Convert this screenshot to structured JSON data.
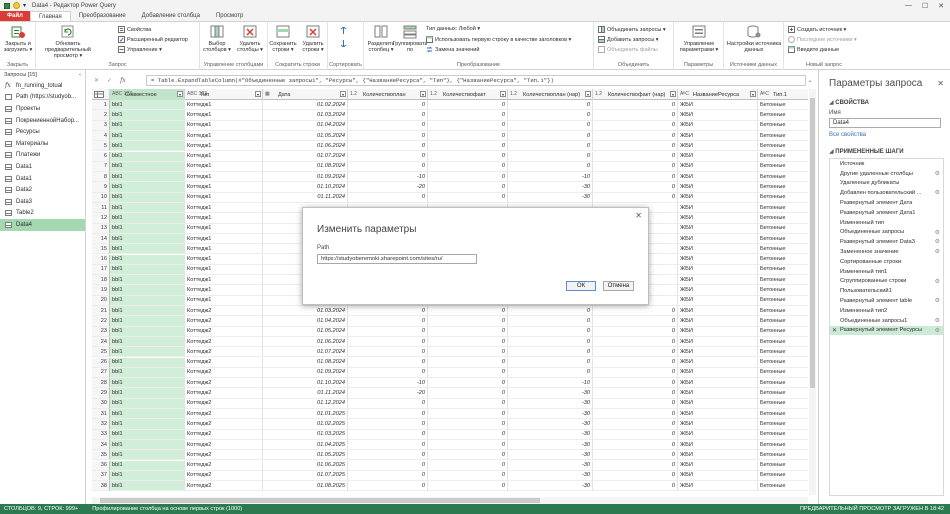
{
  "window": {
    "title": "Data4 - Редактор Power Query",
    "minimize": "—",
    "maximize": "☐",
    "close": "✕"
  },
  "tabs": [
    "Файл",
    "Главная",
    "Преобразование",
    "Добавление столбца",
    "Просмотр"
  ],
  "ribbon": {
    "close_apply": "Закрыть и загрузить ▾",
    "close_group": "Закрыть",
    "refresh": "Обновить предварительный просмотр ▾",
    "properties": "Свойства",
    "advanced_editor": "Расширенный редактор",
    "manage": "Управление ▾",
    "query_group": "Запрос",
    "choose_cols": "Выбор столбцов ▾",
    "remove_cols": "Удалить столбцы ▾",
    "manage_cols_group": "Управление столбцами",
    "keep_rows": "Сохранить строки ▾",
    "remove_rows": "Удалить строки ▾",
    "reduce_rows_group": "Сократить строки",
    "sort_group": "Сортировать",
    "split_col": "Разделить столбец ▾",
    "group_by": "Группировать по",
    "data_type": "Тип данных: Любой ▾",
    "first_row_headers": "Использовать первую строку в качестве заголовков ▾",
    "replace_values": "Замена значений",
    "transform_group": "Преобразование",
    "merge_queries": "Объединить запросы ▾",
    "append_queries": "Добавить запросы ▾",
    "combine_files": "Объединить файлы",
    "combine_group": "Объединить",
    "manage_params": "Управление параметрами ▾",
    "params_group": "Параметры",
    "ds_settings": "Настройки источника данных",
    "ds_group": "Источники данных",
    "new_source": "Создать источник ▾",
    "recent_sources": "Последние источники ▾",
    "enter_data": "Введите данные",
    "new_query_group": "Новый запрос"
  },
  "queries": {
    "header": "Запросы [15]",
    "items": [
      {
        "icon": "fx",
        "name": "fn_running_totual"
      },
      {
        "icon": "param",
        "name": "Path (https://studyob..."
      },
      {
        "icon": "table",
        "name": "Проекты"
      },
      {
        "icon": "table",
        "name": "ПокрениеннойНабор..."
      },
      {
        "icon": "table",
        "name": "Ресурсы"
      },
      {
        "icon": "table",
        "name": "Материалы"
      },
      {
        "icon": "table",
        "name": "Платежи"
      },
      {
        "icon": "table",
        "name": "Data1"
      },
      {
        "icon": "table",
        "name": "Data1"
      },
      {
        "icon": "table",
        "name": "Data2"
      },
      {
        "icon": "table",
        "name": "Data3"
      },
      {
        "icon": "table",
        "name": "Table2"
      },
      {
        "icon": "table",
        "name": "Data4"
      }
    ]
  },
  "formula": {
    "cancel": "✕",
    "apply": "✓",
    "fx": "fx",
    "text": "= Table.ExpandTableColumn(#\"Объединенные запросы1\", \"Ресурсы\", {\"НазваниеРесурса\", \"Тип\"}, {\"НазваниеРесурса\", \"Тип.1\"})"
  },
  "grid": {
    "columns": [
      {
        "type": "ABC\n123",
        "name": "Совместное"
      },
      {
        "type": "ABC\n123",
        "name": "Тип"
      },
      {
        "type": "▦",
        "name": "Дата"
      },
      {
        "type": "1.2",
        "name": "Количествоплан"
      },
      {
        "type": "1.2",
        "name": "Количествофакт"
      },
      {
        "type": "1.2",
        "name": "Количествоплан (нар)"
      },
      {
        "type": "1.2",
        "name": "Количествофакт (нар)"
      },
      {
        "type": "A͏ᴮC",
        "name": "НазваниеРесурса"
      },
      {
        "type": "A͏ᴮC",
        "name": "Тип.1"
      }
    ],
    "rows": [
      [
        "1",
        "bbl1",
        "Коттедж1",
        "01.02.2024",
        "0",
        "0",
        "0",
        "0",
        "ЖБИ",
        "Бетонные"
      ],
      [
        "2",
        "bbl1",
        "Коттедж1",
        "01.03.2024",
        "0",
        "0",
        "0",
        "0",
        "ЖБИ",
        "Бетонные"
      ],
      [
        "3",
        "bbl1",
        "Коттедж1",
        "01.04.2024",
        "0",
        "0",
        "0",
        "0",
        "ЖБИ",
        "Бетонные"
      ],
      [
        "4",
        "bbl1",
        "Коттедж1",
        "01.05.2024",
        "0",
        "0",
        "0",
        "0",
        "ЖБИ",
        "Бетонные"
      ],
      [
        "5",
        "bbl1",
        "Коттедж1",
        "01.06.2024",
        "0",
        "0",
        "0",
        "0",
        "ЖБИ",
        "Бетонные"
      ],
      [
        "6",
        "bbl1",
        "Коттедж1",
        "01.07.2024",
        "0",
        "0",
        "0",
        "0",
        "ЖБИ",
        "Бетонные"
      ],
      [
        "7",
        "bbl1",
        "Коттедж1",
        "01.08.2024",
        "0",
        "0",
        "0",
        "0",
        "ЖБИ",
        "Бетонные"
      ],
      [
        "8",
        "bbl1",
        "Коттедж1",
        "01.09.2024",
        "-10",
        "0",
        "-10",
        "0",
        "ЖБИ",
        "Бетонные"
      ],
      [
        "9",
        "bbl1",
        "Коттедж1",
        "01.10.2024",
        "-20",
        "0",
        "-30",
        "0",
        "ЖБИ",
        "Бетонные"
      ],
      [
        "10",
        "bbl1",
        "Коттедж1",
        "01.11.2024",
        "0",
        "0",
        "-30",
        "0",
        "ЖБИ",
        "Бетонные"
      ],
      [
        "11",
        "bbl1",
        "Коттедж1",
        "",
        "",
        "",
        "",
        "",
        "ЖБИ",
        "Бетонные"
      ],
      [
        "12",
        "bbl1",
        "Коттедж1",
        "",
        "",
        "",
        "",
        "",
        "ЖБИ",
        "Бетонные"
      ],
      [
        "13",
        "bbl1",
        "Коттедж1",
        "",
        "",
        "",
        "",
        "",
        "ЖБИ",
        "Бетонные"
      ],
      [
        "14",
        "bbl1",
        "Коттедж1",
        "",
        "",
        "",
        "",
        "",
        "ЖБИ",
        "Бетонные"
      ],
      [
        "15",
        "bbl1",
        "Коттедж1",
        "",
        "",
        "",
        "",
        "",
        "ЖБИ",
        "Бетонные"
      ],
      [
        "16",
        "bbl1",
        "Коттедж1",
        "",
        "",
        "",
        "",
        "",
        "ЖБИ",
        "Бетонные"
      ],
      [
        "17",
        "bbl1",
        "Коттедж1",
        "",
        "",
        "",
        "",
        "",
        "ЖБИ",
        "Бетонные"
      ],
      [
        "18",
        "bbl1",
        "Коттедж1",
        "",
        "",
        "",
        "",
        "",
        "ЖБИ",
        "Бетонные"
      ],
      [
        "19",
        "bbl1",
        "Коттедж1",
        "",
        "",
        "",
        "",
        "",
        "ЖБИ",
        "Бетонные"
      ],
      [
        "20",
        "bbl1",
        "Коттедж1",
        "",
        "",
        "",
        "",
        "",
        "ЖБИ",
        "Бетонные"
      ],
      [
        "21",
        "bbl1",
        "Коттедж2",
        "01.03.2024",
        "0",
        "0",
        "0",
        "0",
        "ЖБИ",
        "Бетонные"
      ],
      [
        "22",
        "bbl1",
        "Коттедж2",
        "01.04.2024",
        "0",
        "0",
        "0",
        "0",
        "ЖБИ",
        "Бетонные"
      ],
      [
        "23",
        "bbl1",
        "Коттедж2",
        "01.05.2024",
        "0",
        "0",
        "0",
        "0",
        "ЖБИ",
        "Бетонные"
      ],
      [
        "24",
        "bbl1",
        "Коттедж2",
        "01.06.2024",
        "0",
        "0",
        "0",
        "0",
        "ЖБИ",
        "Бетонные"
      ],
      [
        "25",
        "bbl1",
        "Коттедж2",
        "01.07.2024",
        "0",
        "0",
        "0",
        "0",
        "ЖБИ",
        "Бетонные"
      ],
      [
        "26",
        "bbl1",
        "Коттедж2",
        "01.08.2024",
        "0",
        "0",
        "0",
        "0",
        "ЖБИ",
        "Бетонные"
      ],
      [
        "27",
        "bbl1",
        "Коттедж2",
        "01.09.2024",
        "0",
        "0",
        "0",
        "0",
        "ЖБИ",
        "Бетонные"
      ],
      [
        "28",
        "bbl1",
        "Коттедж2",
        "01.10.2024",
        "-10",
        "0",
        "-10",
        "0",
        "ЖБИ",
        "Бетонные"
      ],
      [
        "29",
        "bbl1",
        "Коттедж2",
        "01.11.2024",
        "-20",
        "0",
        "-30",
        "0",
        "ЖБИ",
        "Бетонные"
      ],
      [
        "30",
        "bbl1",
        "Коттедж2",
        "01.12.2024",
        "0",
        "0",
        "-30",
        "0",
        "ЖБИ",
        "Бетонные"
      ],
      [
        "31",
        "bbl1",
        "Коттедж2",
        "01.01.2025",
        "0",
        "0",
        "-30",
        "0",
        "ЖБИ",
        "Бетонные"
      ],
      [
        "32",
        "bbl1",
        "Коттедж2",
        "01.02.2025",
        "0",
        "0",
        "-30",
        "0",
        "ЖБИ",
        "Бетонные"
      ],
      [
        "33",
        "bbl1",
        "Коттедж2",
        "01.03.2025",
        "0",
        "0",
        "-30",
        "0",
        "ЖБИ",
        "Бетонные"
      ],
      [
        "34",
        "bbl1",
        "Коттедж2",
        "01.04.2025",
        "0",
        "0",
        "-30",
        "0",
        "ЖБИ",
        "Бетонные"
      ],
      [
        "35",
        "bbl1",
        "Коттедж2",
        "01.05.2025",
        "0",
        "0",
        "-30",
        "0",
        "ЖБИ",
        "Бетонные"
      ],
      [
        "36",
        "bbl1",
        "Коттедж2",
        "01.06.2025",
        "0",
        "0",
        "-30",
        "0",
        "ЖБИ",
        "Бетонные"
      ],
      [
        "37",
        "bbl1",
        "Коттедж2",
        "01.07.2025",
        "0",
        "0",
        "-30",
        "0",
        "ЖБИ",
        "Бетонные"
      ],
      [
        "38",
        "bbl1",
        "Коттедж2",
        "01.08.2025",
        "0",
        "0",
        "-30",
        "0",
        "ЖБИ",
        "Бетонные"
      ]
    ]
  },
  "settings": {
    "title": "Параметры запроса",
    "close": "✕",
    "props_header": "СВОЙСТВА",
    "name_label": "Имя",
    "name_value": "Data4",
    "all_props": "Все свойства",
    "steps_header": "ПРИМЕНЕННЫЕ ШАГИ",
    "steps": [
      {
        "name": "Источник",
        "gear": false
      },
      {
        "name": "Другие удаленные столбцы",
        "gear": true
      },
      {
        "name": "Удаленные дубликаты",
        "gear": false
      },
      {
        "name": "Добавлен пользовательский ...",
        "gear": true
      },
      {
        "name": "Развернутый элемент Дата",
        "gear": false
      },
      {
        "name": "Развернутый элемент Дата1",
        "gear": false
      },
      {
        "name": "Измененный тип",
        "gear": false
      },
      {
        "name": "Объединенные запросы",
        "gear": true
      },
      {
        "name": "Развернутый элемент Data3",
        "gear": true
      },
      {
        "name": "Замененное значение",
        "gear": true
      },
      {
        "name": "Сортированные строки",
        "gear": false
      },
      {
        "name": "Измененный тип1",
        "gear": false
      },
      {
        "name": "Сгруппированные строки",
        "gear": true
      },
      {
        "name": "Пользовательский1",
        "gear": false
      },
      {
        "name": "Развернутый элемент table",
        "gear": true
      },
      {
        "name": "Измененный тип2",
        "gear": false
      },
      {
        "name": "Объединенные запросы1",
        "gear": true
      },
      {
        "name": "Развернутый элемент Ресурсы",
        "gear": true,
        "active": true
      }
    ]
  },
  "status": {
    "left": "СТОЛБЦОВ: 9, СТРОК: 999+",
    "profile": "Профилирование столбца на основе первых строк (1000)",
    "right": "ПРЕДВАРИТЕЛЬНЫЙ ПРОСМОТР ЗАГРУЖЕН В 18:42"
  },
  "dialog": {
    "title": "Изменить параметры",
    "close": "✕",
    "path_label": "Path",
    "path_value": "https://studyoberemoki.sharepoint.com/sites/ru/",
    "ok": "ОК",
    "cancel": "Отмена"
  },
  "colors": {
    "file_tab": "#d8312c",
    "status": "#217346",
    "selected": "#9fd6ad",
    "link": "#2a6bb5"
  }
}
